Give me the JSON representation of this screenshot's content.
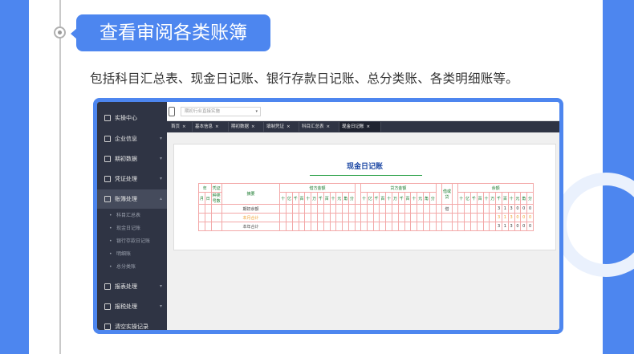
{
  "title": "查看审阅各类账簿",
  "description": "包括科目汇总表、现金日记账、银行存款日记账、总分类账、各类明细账等。",
  "app": {
    "search_placeholder": "期初行业直接实施",
    "sidebar": [
      {
        "label": "实操中心",
        "icon": "check-square-icon"
      },
      {
        "label": "企业信息",
        "icon": "building-icon",
        "arrow": "▾"
      },
      {
        "label": "期初数据",
        "icon": "bar-chart-icon",
        "arrow": "▾"
      },
      {
        "label": "凭证处理",
        "icon": "edit-icon",
        "arrow": "▾"
      },
      {
        "label": "账簿处理",
        "icon": "book-icon",
        "arrow": "▴"
      },
      {
        "label": "报表处理",
        "icon": "line-chart-icon",
        "arrow": "▾"
      },
      {
        "label": "报税处理",
        "icon": "tax-icon",
        "arrow": "▾"
      },
      {
        "label": "清空实操记录",
        "icon": "eraser-icon"
      }
    ],
    "sub_items": [
      "科目汇总表",
      "现金日记账",
      "银行存款日记账",
      "明细账",
      "总分类账"
    ],
    "tabs": [
      "首页",
      "基本信息",
      "期初数据",
      "填制凭证",
      "科目汇总表",
      "现金日记账"
    ],
    "tab_close": "×",
    "ledger": {
      "title": "现金日记账",
      "headers": {
        "year": "年",
        "voucher": "凭证",
        "month": "月",
        "day": "日",
        "type_no": "种类号数",
        "summary": "摘要",
        "debit": "借方金额",
        "credit": "贷方金额",
        "direction": "借或贷",
        "balance": "余额"
      },
      "digit_headers": [
        "十",
        "亿",
        "千",
        "百",
        "十",
        "万",
        "千",
        "百",
        "十",
        "元",
        "角",
        "分"
      ],
      "rows": [
        {
          "summary": "期初余额",
          "direction": "借",
          "balance_digits": [
            "3",
            "1",
            "3",
            "0",
            "0",
            "0"
          ]
        },
        {
          "summary": "本月合计",
          "direction": "",
          "balance_digits": [
            "3",
            "1",
            "3",
            "0",
            "0",
            "0"
          ]
        },
        {
          "summary": "本年合计",
          "direction": "",
          "balance_digits": [
            "3",
            "1",
            "3",
            "0",
            "0",
            "0"
          ]
        }
      ]
    }
  }
}
